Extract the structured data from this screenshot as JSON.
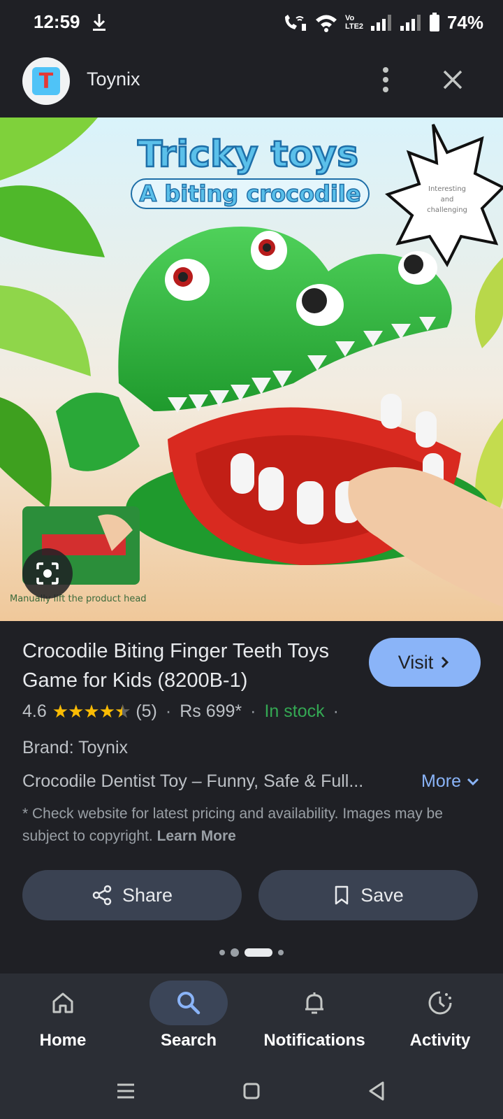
{
  "status_bar": {
    "time": "12:59",
    "battery": "74%",
    "volte_label": "Vo LTE2"
  },
  "header": {
    "logo_letter": "T",
    "site_name": "Toynix"
  },
  "product_image": {
    "title_line1": "Tricky toys",
    "title_line2": "A biting crocodile",
    "burst_text": "Interesting and challenging",
    "caption": "Manually lift the product head"
  },
  "product": {
    "title": "Crocodile Biting Finger Teeth Toys Game for Kids (8200B-1)",
    "visit_label": "Visit",
    "rating": "4.6",
    "rating_value": 4.6,
    "review_count": "(5)",
    "price": "Rs 699*",
    "stock": "In stock",
    "brand": "Brand: Toynix",
    "description": "Crocodile Dentist Toy – Funny, Safe & Full...",
    "more_label": "More",
    "disclaimer": "* Check website for latest pricing and availability. Images may be subject to copyright.",
    "learn_more": "Learn More"
  },
  "actions": {
    "share_label": "Share",
    "save_label": "Save"
  },
  "bottom_nav": {
    "items": [
      {
        "label": "Home",
        "icon": "home-icon"
      },
      {
        "label": "Search",
        "icon": "search-icon",
        "active": true
      },
      {
        "label": "Notifications",
        "icon": "bell-icon"
      },
      {
        "label": "Activity",
        "icon": "activity-icon"
      }
    ]
  },
  "colors": {
    "background": "#1f2025",
    "accent": "#8ab4f8",
    "in_stock": "#34a853",
    "star": "#fbbc04",
    "button_bg": "#3a4252"
  }
}
